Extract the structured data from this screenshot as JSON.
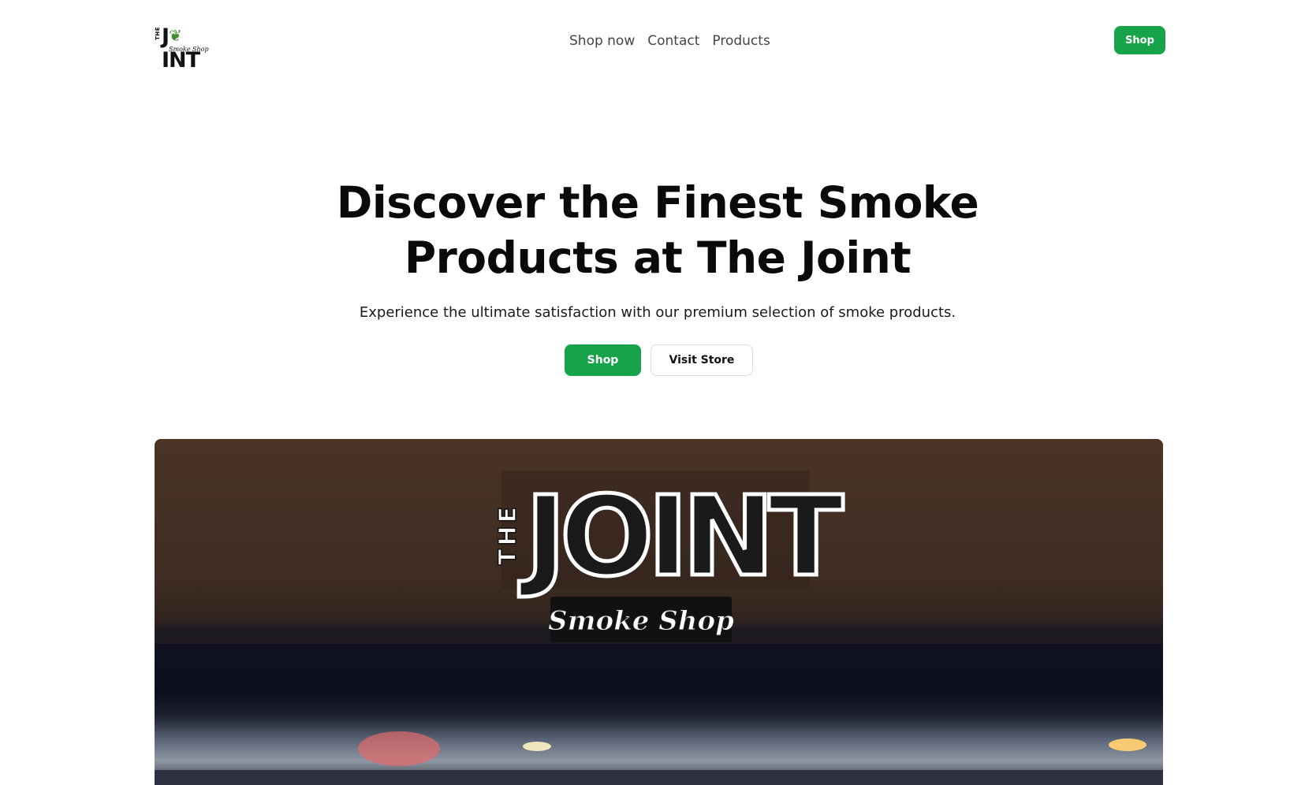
{
  "header": {
    "logo": {
      "the": "THE",
      "joint": "JOINT",
      "tagline": "Smoke Shop"
    },
    "nav": [
      "Shop now",
      "Contact",
      "Products"
    ],
    "shop_button": "Shop"
  },
  "hero": {
    "title": "Discover the Finest Smoke Products at The Joint",
    "subtitle": "Experience the ultimate satisfaction with our premium selection of smoke products.",
    "primary_button": "Shop",
    "secondary_button": "Visit Store"
  },
  "store_image": {
    "sign_the": "THE",
    "sign_joint": "JOINT",
    "sign_tagline": "Smoke Shop"
  },
  "colors": {
    "accent": "#16a34a"
  }
}
